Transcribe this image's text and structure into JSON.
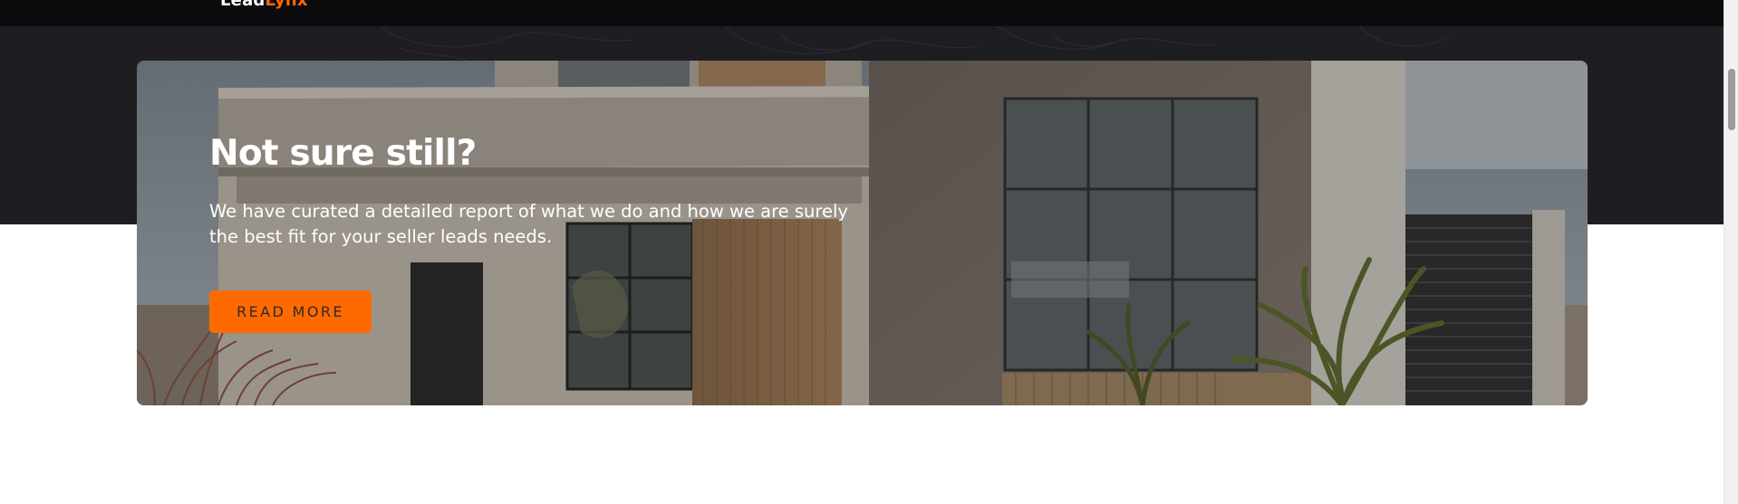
{
  "header": {
    "logo_part1": "Lead",
    "logo_part2": "Lynx"
  },
  "cta": {
    "heading": "Not sure still?",
    "description": "We have curated a detailed report of what we do and how we are surely the best fit for your seller leads needs.",
    "button_label": "READ MORE"
  },
  "colors": {
    "accent": "#ff6a00",
    "header_bg": "#0c0c0f",
    "band_bg": "#1d1d22",
    "page_bg": "#ffffff"
  }
}
